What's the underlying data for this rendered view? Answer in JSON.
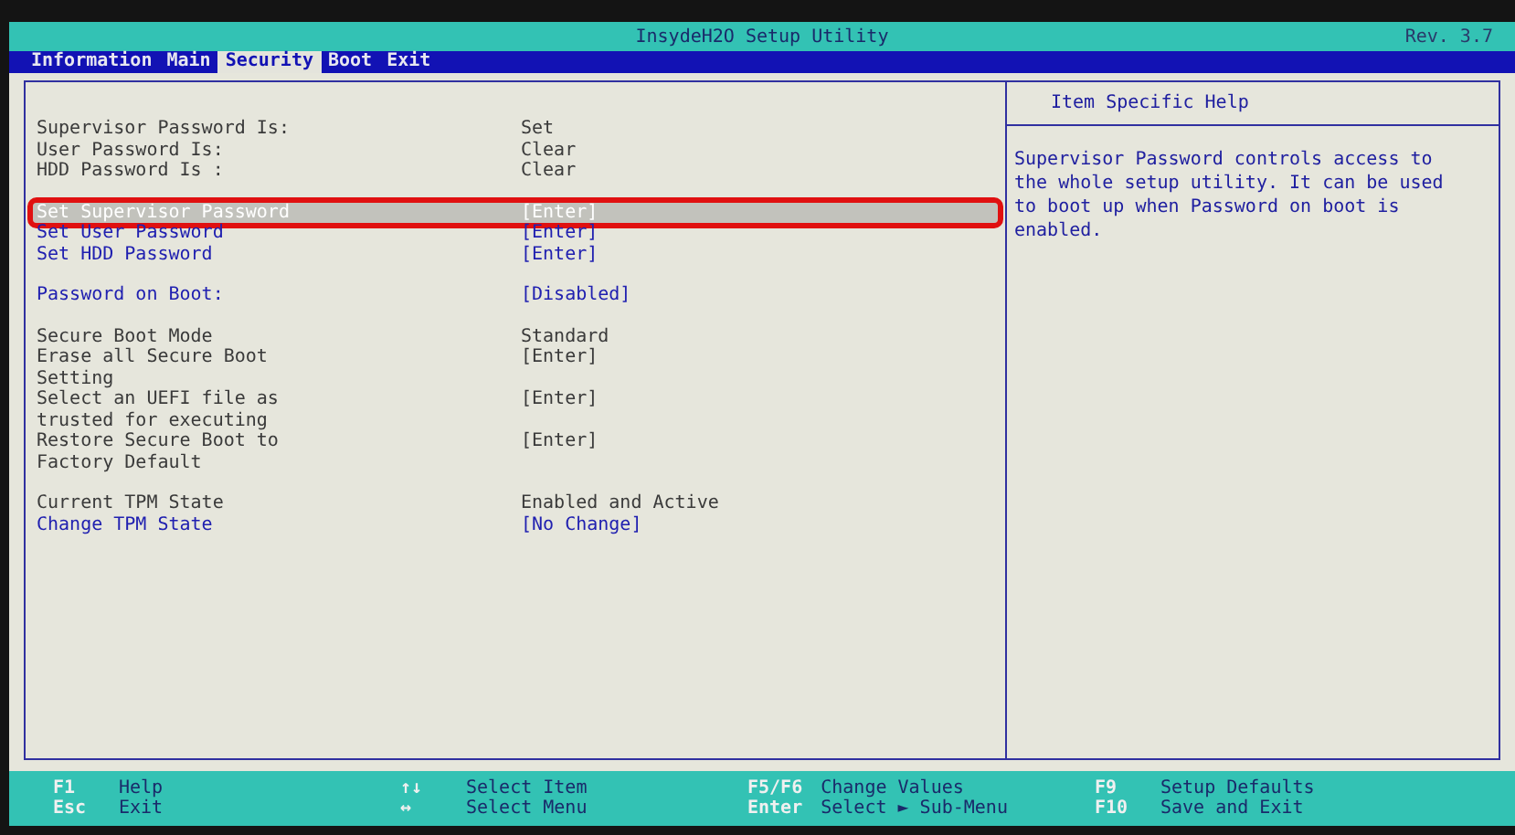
{
  "window": {
    "title": "InsydeH2O Setup Utility",
    "revision": "Rev. 3.7"
  },
  "tabs": [
    {
      "label": "Information",
      "selected": false
    },
    {
      "label": "Main",
      "selected": false
    },
    {
      "label": "Security",
      "selected": true
    },
    {
      "label": "Boot",
      "selected": false
    },
    {
      "label": "Exit",
      "selected": false
    }
  ],
  "groups": [
    {
      "items": [
        {
          "kind": "info",
          "label": "Supervisor Password Is:",
          "value": "Set",
          "selected": false,
          "highlighted": false
        },
        {
          "kind": "info",
          "label": "User Password Is:",
          "value": "Clear",
          "selected": false,
          "highlighted": false
        },
        {
          "kind": "info",
          "label": "HDD Password Is :",
          "value": "Clear",
          "selected": false,
          "highlighted": false
        }
      ]
    },
    {
      "items": [
        {
          "kind": "option",
          "label": "Set Supervisor Password",
          "value": "[Enter]",
          "selected": true,
          "highlighted": true
        },
        {
          "kind": "option",
          "label": "Set User Password",
          "value": "[Enter]",
          "selected": false,
          "highlighted": false
        },
        {
          "kind": "option",
          "label": "Set HDD Password",
          "value": "[Enter]",
          "selected": false,
          "highlighted": false
        }
      ]
    },
    {
      "items": [
        {
          "kind": "option",
          "label": "Password on Boot:",
          "value": "[Disabled]",
          "selected": false,
          "highlighted": false
        }
      ]
    },
    {
      "items": [
        {
          "kind": "info",
          "label": "Secure Boot Mode",
          "value": "Standard",
          "selected": false,
          "highlighted": false
        },
        {
          "kind": "plain",
          "label": "Erase all Secure Boot Setting",
          "value": "[Enter]",
          "selected": false,
          "highlighted": false
        },
        {
          "kind": "plain",
          "label": "Select an UEFI file as trusted for executing",
          "value": "[Enter]",
          "selected": false,
          "highlighted": false
        },
        {
          "kind": "plain",
          "label": "Restore Secure Boot to Factory Default",
          "value": "[Enter]",
          "selected": false,
          "highlighted": false
        }
      ]
    },
    {
      "items": [
        {
          "kind": "info",
          "label": "Current TPM State",
          "value": "Enabled and Active",
          "selected": false,
          "highlighted": false
        },
        {
          "kind": "option",
          "label": "Change TPM State",
          "value": "[No Change]",
          "selected": false,
          "highlighted": false
        }
      ]
    }
  ],
  "help": {
    "title": "Item Specific Help",
    "text": "Supervisor Password controls access to the whole setup utility. It can be used to boot up when Password on boot is enabled."
  },
  "footer": [
    [
      {
        "key": "F1",
        "action": "Help"
      },
      {
        "key": "Esc",
        "action": "Exit"
      }
    ],
    [
      {
        "key": "↑↓",
        "action": "Select Item"
      },
      {
        "key": "↔",
        "action": "Select Menu"
      }
    ],
    [
      {
        "key": "F5/F6",
        "action": "Change Values"
      },
      {
        "key": "Enter",
        "action": "Select ► Sub-Menu"
      }
    ],
    [
      {
        "key": "F9",
        "action": "Setup Defaults"
      },
      {
        "key": "F10",
        "action": "Save and Exit"
      }
    ]
  ]
}
